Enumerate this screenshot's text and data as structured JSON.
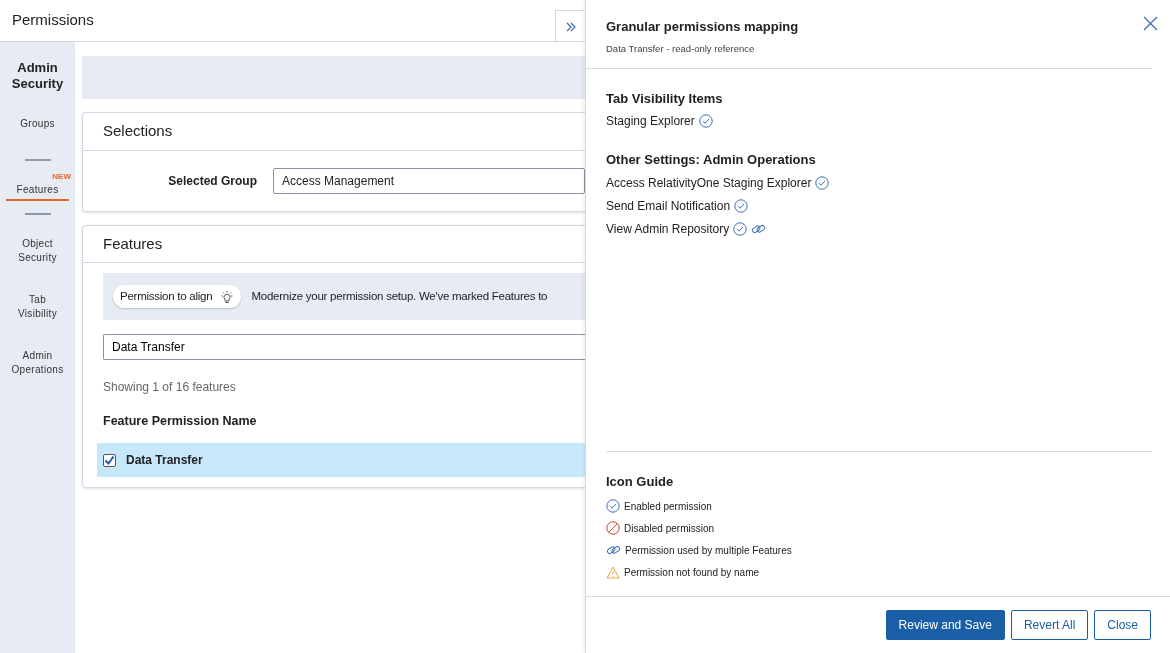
{
  "window": {
    "title": "Permissions"
  },
  "sidebar": {
    "heading": "Admin Security",
    "items": [
      {
        "label": "Groups",
        "selected": false
      },
      {
        "label": "Features",
        "selected": true,
        "badge": "NEW"
      },
      {
        "label": "Object Security",
        "selected": false
      },
      {
        "label": "Tab Visibility",
        "selected": false
      },
      {
        "label": "Admin Operations",
        "selected": false
      }
    ]
  },
  "selections": {
    "title": "Selections",
    "label": "Selected Group",
    "value": "Access Management"
  },
  "features": {
    "title": "Features",
    "tag": "Permission to align",
    "notice": "Modernize your permission setup. We've marked Features to",
    "search": {
      "value": "Data Transfer"
    },
    "count": "Showing 1 of 16 features",
    "column": "Feature Permission Name",
    "rows": [
      {
        "name": "Data Transfer",
        "checked": true,
        "selected": true
      }
    ]
  },
  "panel": {
    "title": "Granular permissions mapping",
    "subtitle": "Data Transfer - read-only reference",
    "sections": [
      {
        "heading": "Tab Visibility Items",
        "items": [
          {
            "label": "Staging Explorer",
            "enabled": true,
            "shared": false
          }
        ]
      },
      {
        "heading": "Other Settings: Admin Operations",
        "items": [
          {
            "label": "Access RelativityOne Staging Explorer",
            "enabled": true,
            "shared": false
          },
          {
            "label": "Send Email Notification",
            "enabled": true,
            "shared": false
          },
          {
            "label": "View Admin Repository",
            "enabled": true,
            "shared": true
          }
        ]
      }
    ],
    "guide": {
      "heading": "Icon Guide",
      "items": [
        {
          "kind": "enabled",
          "label": "Enabled permission"
        },
        {
          "kind": "disabled",
          "label": "Disabled permission"
        },
        {
          "kind": "shared",
          "label": "Permission used by multiple Features"
        },
        {
          "kind": "warning",
          "label": "Permission not found by name"
        }
      ]
    }
  },
  "buttons": [
    {
      "label": "Review and Save",
      "kind": "primary"
    },
    {
      "label": "Revert All",
      "kind": "outline"
    },
    {
      "label": "Close",
      "kind": "outline"
    }
  ]
}
